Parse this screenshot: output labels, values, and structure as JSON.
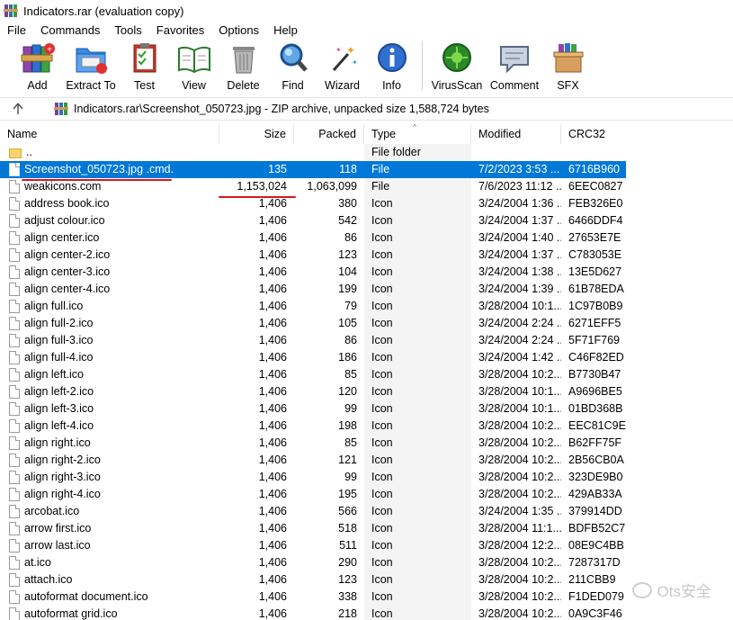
{
  "window": {
    "title": "Indicators.rar (evaluation copy)"
  },
  "menu": [
    "File",
    "Commands",
    "Tools",
    "Favorites",
    "Options",
    "Help"
  ],
  "toolbar": [
    {
      "label": "Add",
      "icon": "add-books-icon"
    },
    {
      "label": "Extract To",
      "icon": "extract-folder-icon"
    },
    {
      "label": "Test",
      "icon": "test-clipboard-icon"
    },
    {
      "label": "View",
      "icon": "view-book-icon"
    },
    {
      "label": "Delete",
      "icon": "trash-can-icon"
    },
    {
      "label": "Find",
      "icon": "magnifier-icon"
    },
    {
      "label": "Wizard",
      "icon": "magic-wand-icon"
    },
    {
      "label": "Info",
      "icon": "info-icon"
    },
    {
      "label": "VirusScan",
      "icon": "virus-scan-icon"
    },
    {
      "label": "Comment",
      "icon": "comment-icon"
    },
    {
      "label": "SFX",
      "icon": "sfx-box-icon"
    }
  ],
  "address": {
    "path": "Indicators.rar\\Screenshot_050723.jpg  - ZIP archive, unpacked size 1,588,724 bytes"
  },
  "columns": {
    "name": "Name",
    "size": "Size",
    "packed": "Packed",
    "type": "Type",
    "modified": "Modified",
    "crc": "CRC32"
  },
  "rows": [
    {
      "name": "..",
      "size": "",
      "packed": "",
      "type": "File folder",
      "modified": "",
      "crc": "",
      "kind": "folder"
    },
    {
      "name": "Screenshot_050723.jpg .cmd.",
      "size": "135",
      "packed": "118",
      "type": "File",
      "modified": "7/2/2023 3:53 ...",
      "crc": "6716B960",
      "kind": "file",
      "selected": true
    },
    {
      "name": "weakicons.com",
      "size": "1,153,024",
      "packed": "1,063,099",
      "type": "File",
      "modified": "7/6/2023 11:12 ...",
      "crc": "6EEC0827",
      "kind": "file"
    },
    {
      "name": "address book.ico",
      "size": "1,406",
      "packed": "380",
      "type": "Icon",
      "modified": "3/24/2004 1:36 ...",
      "crc": "FEB326E0",
      "kind": "file"
    },
    {
      "name": "adjust colour.ico",
      "size": "1,406",
      "packed": "542",
      "type": "Icon",
      "modified": "3/24/2004 1:37 ...",
      "crc": "6466DDF4",
      "kind": "file"
    },
    {
      "name": "align center.ico",
      "size": "1,406",
      "packed": "86",
      "type": "Icon",
      "modified": "3/24/2004 1:40 ...",
      "crc": "27653E7E",
      "kind": "file"
    },
    {
      "name": "align center-2.ico",
      "size": "1,406",
      "packed": "123",
      "type": "Icon",
      "modified": "3/24/2004 1:37 ...",
      "crc": "C783053E",
      "kind": "file"
    },
    {
      "name": "align center-3.ico",
      "size": "1,406",
      "packed": "104",
      "type": "Icon",
      "modified": "3/24/2004 1:38 ...",
      "crc": "13E5D627",
      "kind": "file"
    },
    {
      "name": "align center-4.ico",
      "size": "1,406",
      "packed": "199",
      "type": "Icon",
      "modified": "3/24/2004 1:39 ...",
      "crc": "61B78EDA",
      "kind": "file"
    },
    {
      "name": "align full.ico",
      "size": "1,406",
      "packed": "79",
      "type": "Icon",
      "modified": "3/28/2004 10:1...",
      "crc": "1C97B0B9",
      "kind": "file"
    },
    {
      "name": "align full-2.ico",
      "size": "1,406",
      "packed": "105",
      "type": "Icon",
      "modified": "3/24/2004 2:24 ...",
      "crc": "6271EFF5",
      "kind": "file"
    },
    {
      "name": "align full-3.ico",
      "size": "1,406",
      "packed": "86",
      "type": "Icon",
      "modified": "3/24/2004 2:24 ...",
      "crc": "5F71F769",
      "kind": "file"
    },
    {
      "name": "align full-4.ico",
      "size": "1,406",
      "packed": "186",
      "type": "Icon",
      "modified": "3/24/2004 1:42 ...",
      "crc": "C46F82ED",
      "kind": "file"
    },
    {
      "name": "align left.ico",
      "size": "1,406",
      "packed": "85",
      "type": "Icon",
      "modified": "3/28/2004 10:2...",
      "crc": "B7730B47",
      "kind": "file"
    },
    {
      "name": "align left-2.ico",
      "size": "1,406",
      "packed": "120",
      "type": "Icon",
      "modified": "3/28/2004 10:1...",
      "crc": "A9696BE5",
      "kind": "file"
    },
    {
      "name": "align left-3.ico",
      "size": "1,406",
      "packed": "99",
      "type": "Icon",
      "modified": "3/28/2004 10:1...",
      "crc": "01BD368B",
      "kind": "file"
    },
    {
      "name": "align left-4.ico",
      "size": "1,406",
      "packed": "198",
      "type": "Icon",
      "modified": "3/28/2004 10:2...",
      "crc": "EEC81C9E",
      "kind": "file"
    },
    {
      "name": "align right.ico",
      "size": "1,406",
      "packed": "85",
      "type": "Icon",
      "modified": "3/28/2004 10:2...",
      "crc": "B62FF75F",
      "kind": "file"
    },
    {
      "name": "align right-2.ico",
      "size": "1,406",
      "packed": "121",
      "type": "Icon",
      "modified": "3/28/2004 10:2...",
      "crc": "2B56CB0A",
      "kind": "file"
    },
    {
      "name": "align right-3.ico",
      "size": "1,406",
      "packed": "99",
      "type": "Icon",
      "modified": "3/28/2004 10:2...",
      "crc": "323DE9B0",
      "kind": "file"
    },
    {
      "name": "align right-4.ico",
      "size": "1,406",
      "packed": "195",
      "type": "Icon",
      "modified": "3/28/2004 10:2...",
      "crc": "429AB33A",
      "kind": "file"
    },
    {
      "name": "arcobat.ico",
      "size": "1,406",
      "packed": "566",
      "type": "Icon",
      "modified": "3/24/2004 1:35 ...",
      "crc": "379914DD",
      "kind": "file"
    },
    {
      "name": "arrow first.ico",
      "size": "1,406",
      "packed": "518",
      "type": "Icon",
      "modified": "3/28/2004 11:1...",
      "crc": "BDFB52C7",
      "kind": "file"
    },
    {
      "name": "arrow last.ico",
      "size": "1,406",
      "packed": "511",
      "type": "Icon",
      "modified": "3/28/2004 12:2...",
      "crc": "08E9C4BB",
      "kind": "file"
    },
    {
      "name": "at.ico",
      "size": "1,406",
      "packed": "290",
      "type": "Icon",
      "modified": "3/28/2004 10:2...",
      "crc": "7287317D",
      "kind": "file"
    },
    {
      "name": "attach.ico",
      "size": "1,406",
      "packed": "123",
      "type": "Icon",
      "modified": "3/28/2004 10:2...",
      "crc": "211CBB9",
      "kind": "file"
    },
    {
      "name": "autoformat document.ico",
      "size": "1,406",
      "packed": "338",
      "type": "Icon",
      "modified": "3/28/2004 10:2...",
      "crc": "F1DED079",
      "kind": "file"
    },
    {
      "name": "autoformat grid.ico",
      "size": "1,406",
      "packed": "218",
      "type": "Icon",
      "modified": "3/28/2004 10:2...",
      "crc": "0A9C3F46",
      "kind": "file"
    }
  ],
  "watermark": {
    "text": "Ots安全"
  },
  "colors": {
    "selection": "#0078d7",
    "annotation": "#d4191b"
  }
}
